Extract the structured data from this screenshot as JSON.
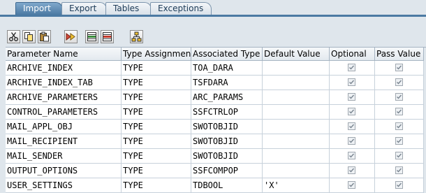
{
  "tabs": [
    {
      "label": "Import",
      "active": true
    },
    {
      "label": "Export",
      "active": false
    },
    {
      "label": "Tables",
      "active": false
    },
    {
      "label": "Exceptions",
      "active": false
    }
  ],
  "toolbar": [
    {
      "name": "cut-button",
      "icon": "scissors-icon"
    },
    {
      "name": "copy-button",
      "icon": "copy-icon"
    },
    {
      "name": "paste-button",
      "icon": "paste-icon"
    },
    {
      "name": "fast-forward-button",
      "icon": "fast-forward-icon"
    },
    {
      "name": "insert-row-button",
      "icon": "insert-row-icon"
    },
    {
      "name": "delete-row-button",
      "icon": "delete-row-icon"
    },
    {
      "name": "where-used-button",
      "icon": "hierarchy-icon"
    }
  ],
  "table": {
    "headers": [
      "Parameter Name",
      "Type Assignment",
      "Associated Type",
      "Default Value",
      "Optional",
      "Pass Value"
    ],
    "rows": [
      {
        "name": "ARCHIVE_INDEX",
        "assign": "TYPE",
        "type": "TOA_DARA",
        "default": "",
        "optional": true,
        "pass": true
      },
      {
        "name": "ARCHIVE_INDEX_TAB",
        "assign": "TYPE",
        "type": "TSFDARA",
        "default": "",
        "optional": true,
        "pass": true
      },
      {
        "name": "ARCHIVE_PARAMETERS",
        "assign": "TYPE",
        "type": "ARC_PARAMS",
        "default": "",
        "optional": true,
        "pass": true
      },
      {
        "name": "CONTROL_PARAMETERS",
        "assign": "TYPE",
        "type": "SSFCTRLOP",
        "default": "",
        "optional": true,
        "pass": true
      },
      {
        "name": "MAIL_APPL_OBJ",
        "assign": "TYPE",
        "type": "SWOTOBJID",
        "default": "",
        "optional": true,
        "pass": true
      },
      {
        "name": "MAIL_RECIPIENT",
        "assign": "TYPE",
        "type": "SWOTOBJID",
        "default": "",
        "optional": true,
        "pass": true
      },
      {
        "name": "MAIL_SENDER",
        "assign": "TYPE",
        "type": "SWOTOBJID",
        "default": "",
        "optional": true,
        "pass": true
      },
      {
        "name": "OUTPUT_OPTIONS",
        "assign": "TYPE",
        "type": "SSFCOMPOP",
        "default": "",
        "optional": true,
        "pass": true
      },
      {
        "name": "USER_SETTINGS",
        "assign": "TYPE",
        "type": "TDBOOL",
        "default": "'X'",
        "optional": true,
        "pass": true
      }
    ]
  }
}
